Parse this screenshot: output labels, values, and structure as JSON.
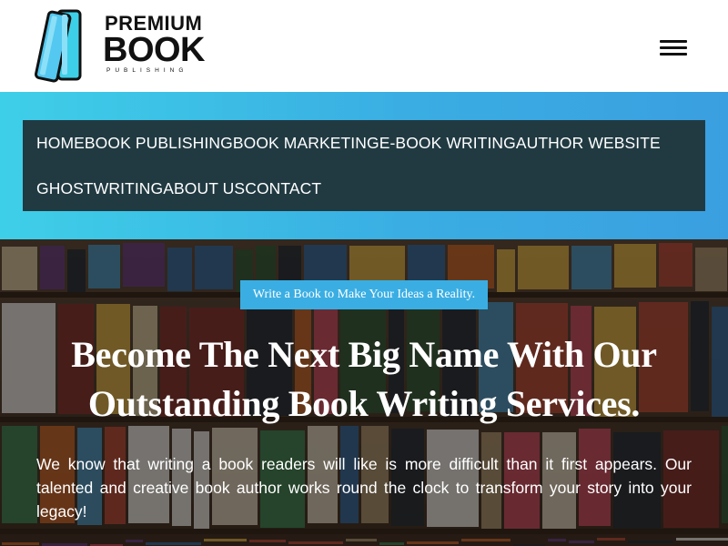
{
  "brand": {
    "line1": "PREMIUM",
    "line2": "BOOK",
    "line3": "PUBLISHING",
    "colors": {
      "icon_fill": "#3ecfe8",
      "icon_stroke": "#111111",
      "text": "#111111"
    }
  },
  "header": {
    "menu_icon": "hamburger-menu-icon"
  },
  "nav": {
    "items": [
      {
        "label": "HOME"
      },
      {
        "label": "BOOK PUBLISHING"
      },
      {
        "label": "BOOK MARKETING"
      },
      {
        "label": "E-BOOK WRITING"
      },
      {
        "label": "AUTHOR WEBSITE"
      },
      {
        "label": "GHOSTWRITING"
      },
      {
        "label": "ABOUT US"
      },
      {
        "label": "CONTACT"
      }
    ],
    "colors": {
      "band_start": "#3ecfe8",
      "band_end": "#3a9fe0",
      "box": "#213a42",
      "text": "#ffffff"
    }
  },
  "hero": {
    "tagline": "Write a Book to Make Your Ideas a Reality.",
    "title_line1": "Become The Next Big Name With Our",
    "title_line2": "Outstanding Book Writing Services.",
    "description": "We know that writing a book readers will like is more difficult than it first appears. Our talented and creative book author works round the clock to transform your story into your legacy!",
    "background": "bookstore-shelves-photo",
    "colors": {
      "tagline_bg": "#3aaee3",
      "text": "#ffffff"
    }
  }
}
